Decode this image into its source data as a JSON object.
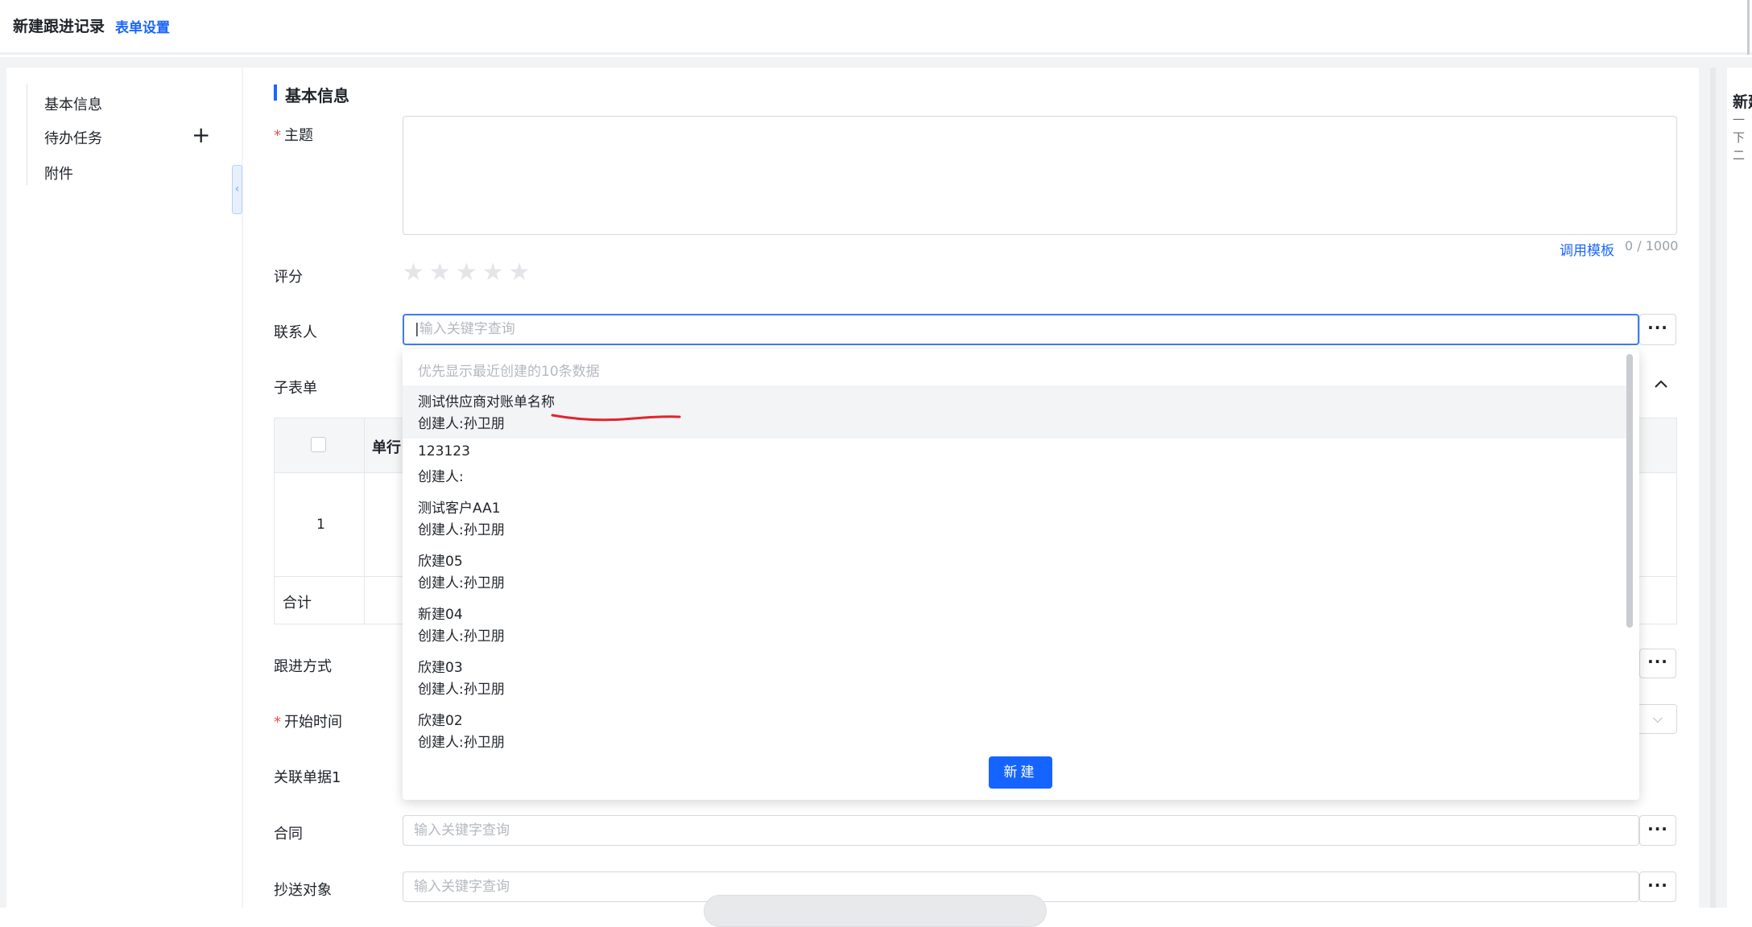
{
  "header": {
    "title": "新建跟进记录",
    "form_settings": "表单设置"
  },
  "sidebar": {
    "items": [
      {
        "label": "基本信息"
      },
      {
        "label": "待办任务"
      },
      {
        "label": "附件"
      }
    ]
  },
  "section": {
    "title": "基本信息"
  },
  "fields": {
    "subject": {
      "label": "主题",
      "template_link": "调用模板",
      "char_count": "0 / 1000"
    },
    "rating": {
      "label": "评分",
      "value": 0,
      "max": 5
    },
    "contact": {
      "label": "联系人",
      "placeholder": "输入关键字查询"
    },
    "subform": {
      "label": "子表单",
      "header_label": "单行",
      "row_number": "1",
      "total_label": "合计"
    },
    "followup_method": {
      "label": "跟进方式"
    },
    "start_time": {
      "label": "开始时间"
    },
    "related_doc": {
      "label": "关联单据1"
    },
    "contract": {
      "label": "合同",
      "placeholder": "输入关键字查询"
    },
    "cc": {
      "label": "抄送对象",
      "placeholder": "输入关键字查询"
    }
  },
  "dropdown": {
    "hint": "优先显示最近创建的10条数据",
    "items": [
      {
        "name": "测试供应商对账单名称",
        "creator": "创建人:孙卫朋"
      },
      {
        "name": "123123",
        "creator": "创建人:"
      },
      {
        "name": "测试客户AA1",
        "creator": "创建人:孙卫朋"
      },
      {
        "name": "欣建05",
        "creator": "创建人:孙卫朋"
      },
      {
        "name": "新建04",
        "creator": "创建人:孙卫朋"
      },
      {
        "name": "欣建03",
        "creator": "创建人:孙卫朋"
      },
      {
        "name": "欣建02",
        "creator": "创建人:孙卫朋"
      }
    ],
    "new_button": "新建"
  },
  "right_panel": {
    "line1": "新建",
    "line2": "一",
    "line3": "下",
    "line4": "二"
  },
  "colors": {
    "accent": "#1664ff",
    "required": "#f54a45",
    "annotation": "#e0252d"
  }
}
